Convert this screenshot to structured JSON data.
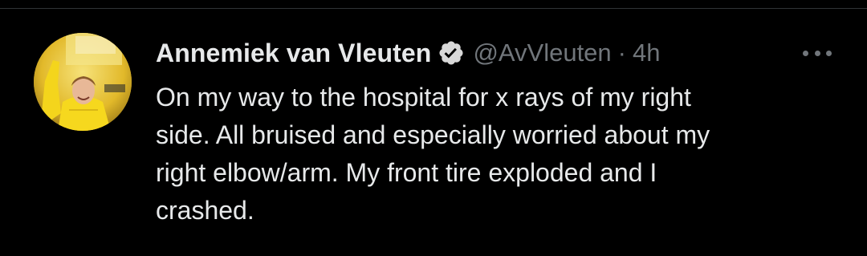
{
  "tweet": {
    "author": {
      "display_name": "Annemiek van Vleuten",
      "handle": "@AvVleuten",
      "verified_icon": "verified-badge-icon",
      "avatar": "avatar"
    },
    "separator": "·",
    "time": "4h",
    "more_icon": "more-options-icon",
    "text_lines": [
      "On my way to the hospital for x rays of my right",
      "side. All bruised and especially worried about my",
      "right elbow/arm. My front tire exploded and I",
      "crashed."
    ]
  },
  "colors": {
    "background": "#000000",
    "primary_text": "#e7e9ea",
    "secondary_text": "#71767b",
    "divider": "#2f3336",
    "avatar_yellow": "#f0d02a"
  }
}
